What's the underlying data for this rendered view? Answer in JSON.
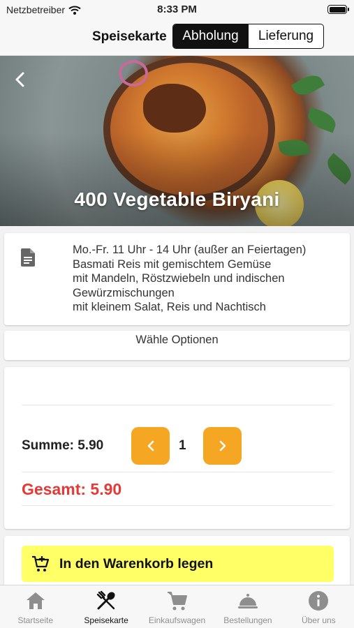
{
  "status_bar": {
    "carrier": "Netzbetreiber",
    "time": "8:33 PM"
  },
  "nav": {
    "title": "Speisekarte",
    "segments": [
      "Abholung",
      "Lieferung"
    ],
    "active_segment": "Abholung"
  },
  "dish": {
    "title": "400 Vegetable Biryani"
  },
  "description": {
    "lines": [
      "Mo.-Fr. 11 Uhr - 14 Uhr (außer an Feiertagen)",
      "Basmati Reis mit gemischtem Gemüse",
      "mit Mandeln, Röstzwiebeln und indischen Gewürzmischungen",
      "mit kleinem Salat, Reis und Nachtisch"
    ]
  },
  "options": {
    "label": "Wähle Optionen"
  },
  "order": {
    "summe": "Summe: 5.90",
    "quantity": "1",
    "gesamt": "Gesamt: 5.90"
  },
  "cart": {
    "label": "In den Warenkorb legen"
  },
  "tabs": [
    {
      "label": "Startseite",
      "icon": "home-icon"
    },
    {
      "label": "Speisekarte",
      "icon": "cutlery-icon"
    },
    {
      "label": "Einkaufswagen",
      "icon": "cart-icon"
    },
    {
      "label": "Bestellungen",
      "icon": "cloche-icon"
    },
    {
      "label": "Über uns",
      "icon": "info-icon"
    }
  ],
  "active_tab": "Speisekarte",
  "colors": {
    "accent": "#f5a623",
    "cart_button": "#ffff66",
    "total": "#e53935",
    "segment_active": "#111111"
  }
}
